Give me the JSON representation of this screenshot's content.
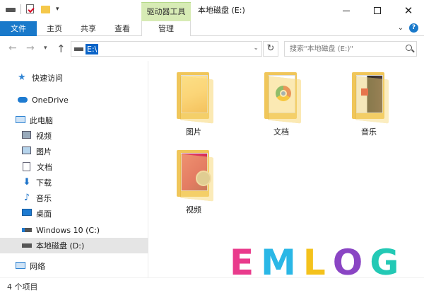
{
  "window": {
    "title": "本地磁盘 (E:)",
    "contextual_tab": "驱动器工具"
  },
  "ribbon": {
    "tabs": [
      "文件",
      "主页",
      "共享",
      "查看",
      "管理"
    ],
    "help": "?"
  },
  "address": {
    "path": "E:\\",
    "search_placeholder": "搜索\"本地磁盘 (E:)\""
  },
  "nav": {
    "quick_access": "快速访问",
    "onedrive": "OneDrive",
    "this_pc": "此电脑",
    "items": [
      {
        "label": "视频",
        "icon": "video-icon"
      },
      {
        "label": "图片",
        "icon": "pictures-icon"
      },
      {
        "label": "文档",
        "icon": "documents-icon"
      },
      {
        "label": "下载",
        "icon": "download-icon"
      },
      {
        "label": "音乐",
        "icon": "music-icon"
      },
      {
        "label": "桌面",
        "icon": "desktop-icon"
      },
      {
        "label": "Windows 10 (C:)",
        "icon": "windows-drive-icon"
      },
      {
        "label": "本地磁盘 (D:)",
        "icon": "drive-icon",
        "selected": true
      }
    ],
    "network": "网络"
  },
  "content": {
    "folders": [
      {
        "label": "图片"
      },
      {
        "label": "文档"
      },
      {
        "label": "音乐"
      },
      {
        "label": "视频"
      }
    ]
  },
  "status": {
    "item_count": "4 个项目"
  },
  "watermark": {
    "letters": [
      "E",
      "M",
      "L",
      "O",
      "G"
    ],
    "colors": [
      "#e93b8c",
      "#2ab7e6",
      "#f4c21c",
      "#8a45c4",
      "#23c9b5"
    ]
  }
}
